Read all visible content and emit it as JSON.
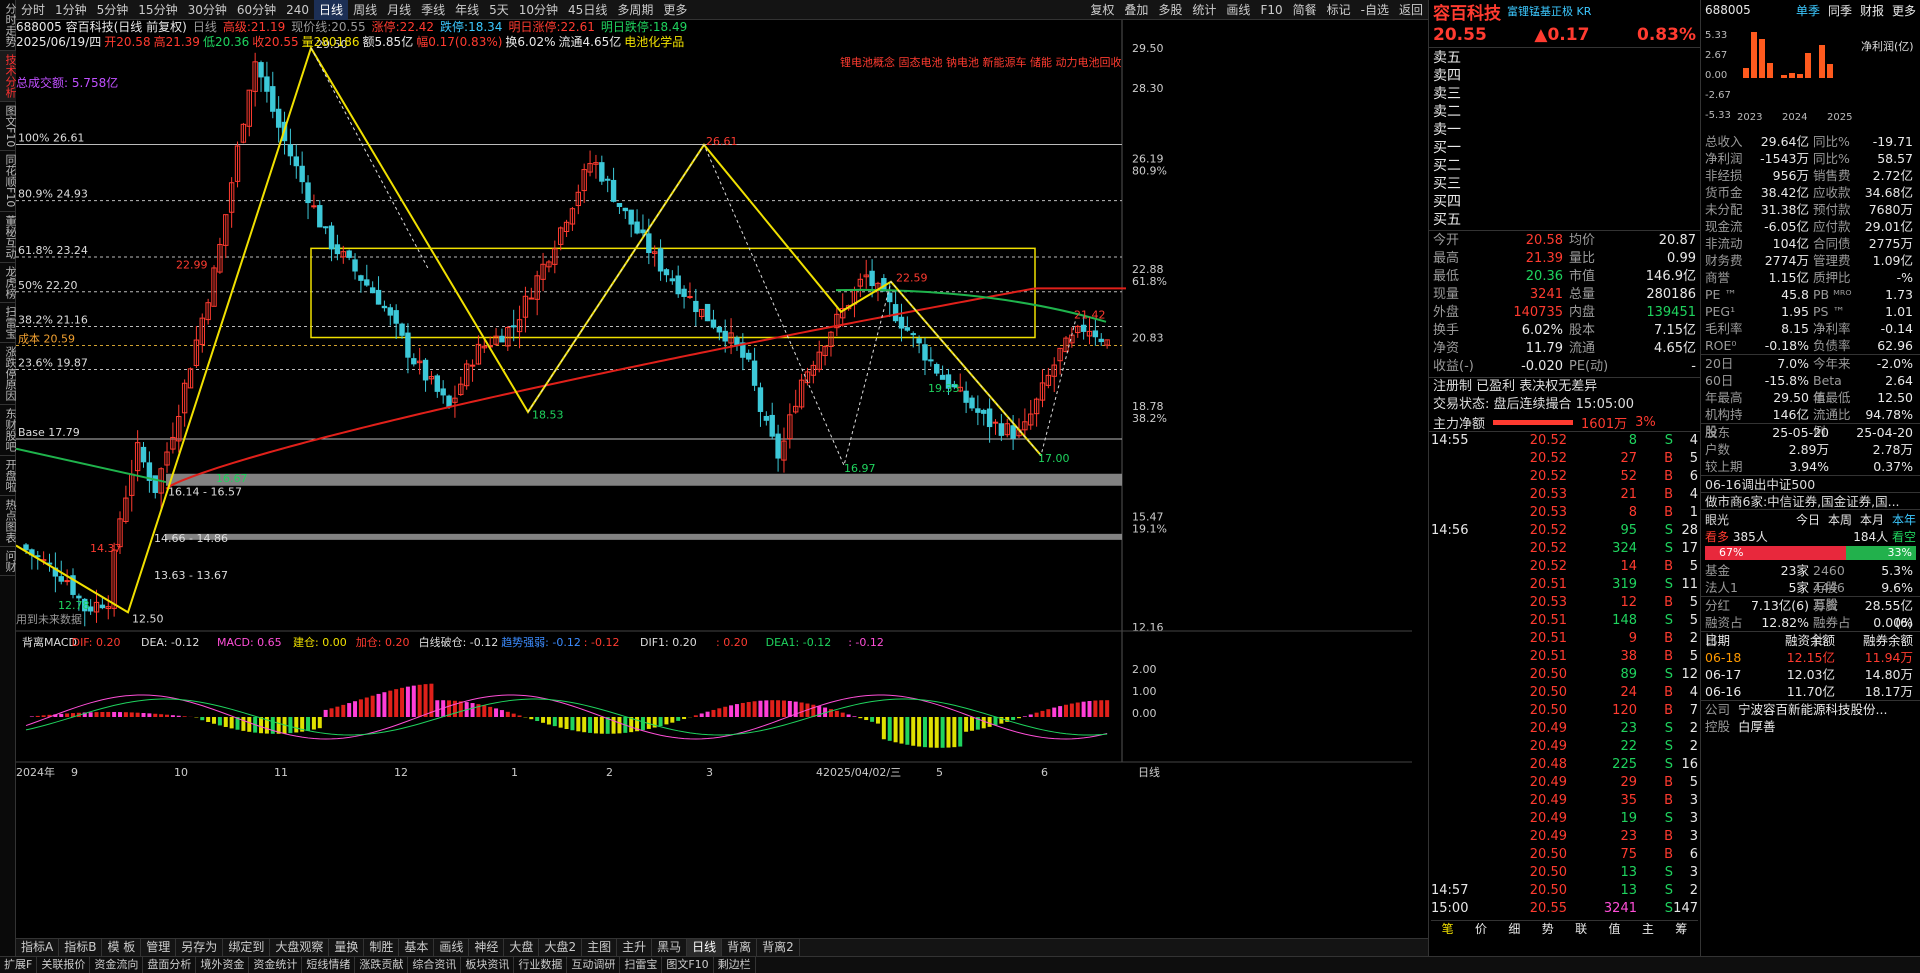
{
  "left_nav": [
    "分时走势",
    "技术分析",
    "图文F10",
    "同花顺F10",
    "董秘互动",
    "龙虎榜",
    "扫雷宝",
    "涨跌停原因",
    "东财股吧",
    "开盘啦",
    "热点图表",
    "问财"
  ],
  "top_tabs": [
    "分时",
    "1分钟",
    "5分钟",
    "15分钟",
    "30分钟",
    "60分钟",
    "240",
    "日线",
    "周线",
    "月线",
    "季线",
    "年线",
    "5天",
    "10分钟",
    "45日线",
    "多周期",
    "更多"
  ],
  "active_tab": "日线",
  "top_tools": [
    "复权",
    "叠加",
    "多股",
    "统计",
    "画线",
    "F10",
    "简餐",
    "标记",
    "-自选",
    "返回"
  ],
  "info": {
    "line1": [
      "688005 容百科技(日线 前复权)",
      "日线",
      "高级:21.19",
      "现价线:20.55",
      "涨停:22.42",
      "跌停:18.34",
      "明日涨停:22.61",
      "明日跌停:18.49"
    ],
    "line2": [
      "2025/06/19/四",
      "开20.58",
      "高21.39",
      "低20.36",
      "收20.55",
      "量280186",
      "额5.85亿",
      "幅0.17(0.83%)",
      "换6.02%",
      "流通4.65亿",
      "电池化学品"
    ],
    "total_vol": "总成交额: 5.758亿",
    "concepts": "锂电池概念 固态电池 钠电池 新能源车 储能 动力电池回收"
  },
  "chart_data": {
    "type": "candlestick",
    "y_axis": [
      29.5,
      28.3,
      26.19,
      22.88,
      20.83,
      18.78,
      15.47,
      12.16
    ],
    "y_pct": [
      "80.9%",
      "61.8%",
      "38.2%",
      "19.1%"
    ],
    "fib_labels": [
      "100% 26.61",
      "80.9% 24.93",
      "61.8% 23.24",
      "50% 22.20",
      "38.2% 21.16",
      "成本 20.59",
      "23.6% 19.87",
      "Base 17.79"
    ],
    "annotations": [
      "29.50",
      "22.99",
      "26.61",
      "22.59",
      "21.42",
      "18.53",
      "16.67",
      "16.97",
      "17.00",
      "19.33",
      "16.14 - 16.57",
      "14.66 - 14.86",
      "13.63 - 13.67",
      "14.37",
      "12.78",
      "12.50"
    ],
    "x_labels": [
      "2024年",
      "9",
      "10",
      "11",
      "12",
      "1",
      "2",
      "3",
      "42025/04/02/三",
      "5",
      "6"
    ],
    "note": "用到未来数据",
    "period": "日线",
    "macd": {
      "title": "背离MACD",
      "dif": "DIF: 0.20",
      "dea": "DEA: -0.12",
      "macd": "MACD: 0.65",
      "jc": "建仓: 0.00",
      "jia": "加仓: 0.20",
      "bai": "白线破仓: -0.12",
      "trend": "趋势强弱: -0.12",
      "x": ": -0.12",
      "dif1": "DIF1: 0.20",
      "y": ": 0.20",
      "dea1": "DEA1: -0.12",
      "z": ": -0.12",
      "axis": [
        "2.00",
        "1.00",
        "0.00"
      ]
    }
  },
  "bottom_tabs1": [
    "指标A",
    "指标B",
    "模 板",
    "管理",
    "另存为",
    "绑定到",
    "大盘观察",
    "量换",
    "制胜",
    "基本",
    "画线",
    "神经",
    "大盘",
    "大盘2",
    "主图",
    "主升",
    "黑马",
    "日线",
    "背离",
    "背离2"
  ],
  "bottom_tabs2": [
    "扩展F",
    "关联报价",
    "资金流向",
    "盘面分析",
    "境外资金",
    "资金统计",
    "短线情绪",
    "涨跌贡献",
    "综合资讯",
    "板块资讯",
    "行业数据",
    "互动调研",
    "扫雷宝",
    "图文F10",
    "剩边栏"
  ],
  "quote": {
    "name": "容百科技",
    "tags": "富锂锰基正极 KR",
    "price": "20.55",
    "chg": "▲0.17",
    "pct": "0.83%",
    "sells": [
      "卖五",
      "卖四",
      "卖三",
      "卖二",
      "卖一"
    ],
    "buys": [
      "买一",
      "买二",
      "买三",
      "买四",
      "买五"
    ],
    "kv": [
      [
        "今开",
        "20.58",
        "均价",
        "20.87"
      ],
      [
        "最高",
        "21.39",
        "量比",
        "0.99"
      ],
      [
        "最低",
        "20.36",
        "市值",
        "146.9亿"
      ],
      [
        "现量",
        "3241",
        "总量",
        "280186"
      ],
      [
        "外盘",
        "140735",
        "内盘",
        "139451"
      ],
      [
        "换手",
        "6.02%",
        "股本",
        "7.15亿"
      ],
      [
        "净资",
        "11.79",
        "流通",
        "4.65亿"
      ],
      [
        "收益(-)",
        "-0.020",
        "PE(动)",
        "-"
      ]
    ],
    "reg": "注册制 已盈利 表决权无差异",
    "trade_state": "交易状态: 盘后连续撮合 15:05:00",
    "main_flow_label": "主力净额",
    "main_flow": "1601万",
    "main_flow_pct": "3%",
    "ticks_time1": "14:55",
    "ticks_time2": "14:56",
    "ticks_time3": "14:57",
    "ticks_time4": "15:00",
    "ticks": [
      [
        "20.52",
        "8",
        "S",
        "4"
      ],
      [
        "20.52",
        "27",
        "B",
        "5"
      ],
      [
        "20.52",
        "52",
        "B",
        "6"
      ],
      [
        "20.53",
        "21",
        "B",
        "4"
      ],
      [
        "20.53",
        "8",
        "B",
        "1"
      ],
      [
        "20.52",
        "95",
        "S",
        "28"
      ],
      [
        "20.52",
        "324",
        "S",
        "17"
      ],
      [
        "20.52",
        "14",
        "B",
        "5"
      ],
      [
        "20.51",
        "319",
        "S",
        "11"
      ],
      [
        "20.53",
        "12",
        "B",
        "5"
      ],
      [
        "20.51",
        "148",
        "S",
        "5"
      ],
      [
        "20.51",
        "9",
        "B",
        "2"
      ],
      [
        "20.51",
        "38",
        "B",
        "5"
      ],
      [
        "20.50",
        "89",
        "S",
        "12"
      ],
      [
        "20.50",
        "24",
        "B",
        "4"
      ],
      [
        "20.50",
        "120",
        "B",
        "7"
      ],
      [
        "20.49",
        "23",
        "S",
        "2"
      ],
      [
        "20.49",
        "22",
        "S",
        "2"
      ],
      [
        "20.48",
        "225",
        "S",
        "16"
      ],
      [
        "20.49",
        "29",
        "B",
        "5"
      ],
      [
        "20.49",
        "35",
        "B",
        "3"
      ],
      [
        "20.49",
        "19",
        "S",
        "3"
      ],
      [
        "20.49",
        "23",
        "B",
        "3"
      ],
      [
        "20.50",
        "75",
        "B",
        "6"
      ],
      [
        "20.50",
        "13",
        "S",
        "3"
      ],
      [
        "20.50",
        "13",
        "S",
        "2"
      ],
      [
        "20.55",
        "3241",
        "S",
        "147"
      ]
    ],
    "tick_tabs": [
      "笔",
      "价",
      "细",
      "势",
      "联",
      "值",
      "主",
      "筹"
    ]
  },
  "fund": {
    "code": "688005",
    "tabs": [
      "单季",
      "同季",
      "财报",
      "更多"
    ],
    "chart_y": [
      "5.33",
      "2.67",
      "0.00",
      "-2.67",
      "-5.33"
    ],
    "chart_title": "净利润(亿)",
    "chart_x": [
      "2023",
      "2024",
      "2025"
    ],
    "bars": [
      1.0,
      4.6,
      3.9,
      1.5,
      0.3,
      0.5,
      0.4,
      2.5,
      3.3,
      1.4
    ],
    "rows": [
      [
        "总收入",
        "29.64亿",
        "同比%",
        "-19.71"
      ],
      [
        "净利润",
        "-1543万",
        "同比%",
        "58.57"
      ],
      [
        "非经损",
        "956万",
        "销售费",
        "2.72亿"
      ],
      [
        "货币金",
        "38.42亿",
        "应收款",
        "34.68亿"
      ],
      [
        "未分配",
        "31.38亿",
        "预付款",
        "7680万"
      ],
      [
        "现金流",
        "-6.05亿",
        "应付款",
        "29.01亿"
      ],
      [
        "非流动",
        "104亿",
        "合同债",
        "2775万"
      ],
      [
        "财务费",
        "2774万",
        "管理费",
        "1.09亿"
      ],
      [
        "商誉",
        "1.15亿",
        "质押比",
        "-%"
      ],
      [
        "PE ™",
        "45.8",
        "PB ᴹᴿᴼ",
        "1.73"
      ],
      [
        "PEG¹",
        "1.95",
        "PS ™",
        "1.01"
      ],
      [
        "毛利率",
        "8.15",
        "净利率",
        "-0.14"
      ],
      [
        "ROE⁰",
        "-0.18%",
        "负债率",
        "62.96"
      ]
    ],
    "rows2": [
      [
        "20日",
        "7.0%",
        "今年来",
        "-2.0%"
      ],
      [
        "60日",
        "-15.8%",
        "Beta值",
        "2.64"
      ],
      [
        "年最高",
        "29.50",
        "年最低",
        "12.50"
      ],
      [
        "机构持股",
        "146亿",
        "流通比例",
        "94.78%"
      ]
    ],
    "holders": [
      [
        "股东",
        "25-05-20",
        "25-04-20"
      ],
      [
        "户数",
        "2.89万",
        "2.78万"
      ],
      [
        "较上期",
        "3.94%",
        "0.37%"
      ]
    ],
    "news1": "06-16调出中证500",
    "news2": "做市商6家:中信证券,国金证券,国...",
    "eye": "眼光",
    "eye_tabs": [
      "今日",
      "本周",
      "本月",
      "本年"
    ],
    "bull": "看多",
    "bull_n": "385人",
    "bear": "看空",
    "bear_n": "184人",
    "bull_pct": "67%",
    "bear_pct": "33%",
    "inst": [
      [
        "基金",
        "23家",
        "2460万股",
        "5.3%"
      ],
      [
        "法人1",
        "5家",
        "4446万股",
        "9.6%"
      ]
    ],
    "div": [
      [
        "分红",
        "7.13亿(6)",
        "募资",
        "28.55亿(6)"
      ],
      [
        "融资占比",
        "12.82%",
        "融券占比",
        "0.00%"
      ]
    ],
    "margin_head": [
      "日期",
      "融资余额",
      "融券余额"
    ],
    "margin": [
      [
        "06-18",
        "12.15亿",
        "11.94万"
      ],
      [
        "06-17",
        "12.03亿",
        "14.80万"
      ],
      [
        "06-16",
        "11.70亿",
        "18.17万"
      ]
    ],
    "company_label": "公司",
    "company": "宁波容百新能源科技股份...",
    "ctrl_label": "控股",
    "ctrl": "白厚善"
  }
}
